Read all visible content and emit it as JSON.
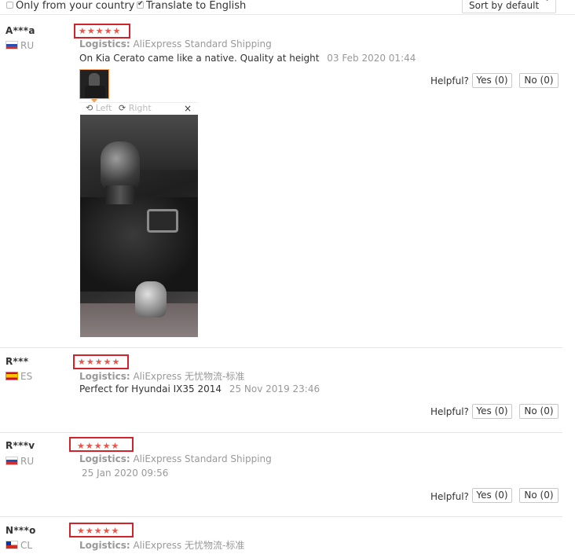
{
  "filters": {
    "only_country": {
      "label": "Only from your country",
      "checked": false
    },
    "translate": {
      "label": "Translate to English",
      "checked": true
    },
    "sort": {
      "label": "Sort by default",
      "chevron": "ˇ"
    }
  },
  "colors": {
    "star": "#e8554a",
    "highlight_border": "#d0232b",
    "muted": "#999999"
  },
  "reviews": [
    {
      "user": "A***a",
      "country": "RU",
      "stars": "★★★★★",
      "rating": 5,
      "logistics_label": "Logistics:",
      "logistics": "AliExpress Standard Shipping",
      "feedback": "On Kia Cerato came like a native. Quality at height",
      "date": "03 Feb 2020 01:44",
      "helpful_label": "Helpful?",
      "yes": "Yes (0)",
      "no": "No (0)",
      "viewer": {
        "left": "Left",
        "right": "Right",
        "close": "×",
        "rotate_left_icon": "⟲",
        "rotate_right_icon": "⟳"
      }
    },
    {
      "user": "R***",
      "country": "ES",
      "stars": "★★★★★",
      "rating": 5,
      "logistics_label": "Logistics:",
      "logistics": "AliExpress 无忧物流-标准",
      "feedback": "Perfect for Hyundai IX35 2014",
      "date": "25 Nov 2019 23:46",
      "helpful_label": "Helpful?",
      "yes": "Yes (0)",
      "no": "No (0)"
    },
    {
      "user": "R***v",
      "country": "RU",
      "stars": "★★★★★",
      "rating": 5,
      "logistics_label": "Logistics:",
      "logistics": "AliExpress Standard Shipping",
      "date": "25 Jan 2020 09:56",
      "helpful_label": "Helpful?",
      "yes": "Yes (0)",
      "no": "No (0)"
    },
    {
      "user": "N***o",
      "country": "CL",
      "stars": "★★★★★",
      "rating": 5,
      "logistics_label": "Logistics:",
      "logistics": "AliExpress 无忧物流-标准"
    }
  ]
}
